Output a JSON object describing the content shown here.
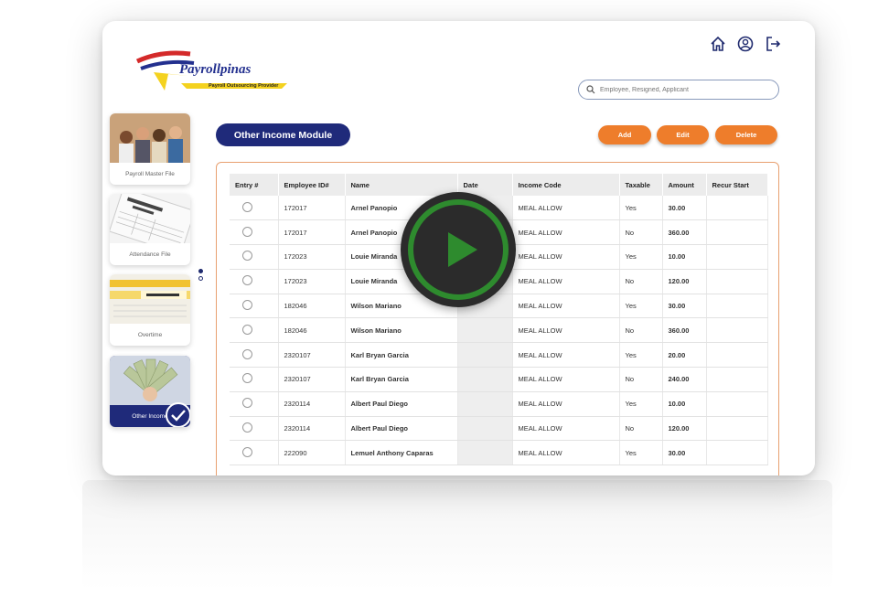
{
  "app": {
    "logo_text": "Payrollpinas",
    "logo_subtitle": "Payroll Outsourcing Provider"
  },
  "header_icons": [
    "home-icon",
    "user-icon",
    "logout-icon"
  ],
  "search": {
    "placeholder": "Employee, Resigned, Applicant"
  },
  "sidebar": {
    "items": [
      {
        "label": "Payroll Master File"
      },
      {
        "label": "Attendance File"
      },
      {
        "label": "Overtime"
      },
      {
        "label": "Other Income",
        "selected": true
      }
    ]
  },
  "module": {
    "title": "Other Income Module"
  },
  "toolbar": {
    "add_label": "Add",
    "edit_label": "Edit",
    "delete_label": "Delete"
  },
  "colors": {
    "primary": "#1f2a7a",
    "accent": "#ee7d2b",
    "play_ring": "#2e8b2e"
  },
  "table": {
    "columns": [
      "Entry #",
      "Employee ID#",
      "Name",
      "Date",
      "Income Code",
      "Taxable",
      "Amount",
      "Recur Start"
    ],
    "rows": [
      {
        "id": "172017",
        "name": "Arnel Panopio",
        "date": "",
        "code": "MEAL ALLOW",
        "taxable": "Yes",
        "amount": "30.00",
        "recur": ""
      },
      {
        "id": "172017",
        "name": "Arnel Panopio",
        "date": "",
        "code": "MEAL ALLOW",
        "taxable": "No",
        "amount": "360.00",
        "recur": ""
      },
      {
        "id": "172023",
        "name": "Louie Miranda",
        "date": "",
        "code": "MEAL ALLOW",
        "taxable": "Yes",
        "amount": "10.00",
        "recur": ""
      },
      {
        "id": "172023",
        "name": "Louie Miranda",
        "date": "",
        "code": "MEAL ALLOW",
        "taxable": "No",
        "amount": "120.00",
        "recur": ""
      },
      {
        "id": "182046",
        "name": "Wilson Mariano",
        "date": "",
        "code": "MEAL ALLOW",
        "taxable": "Yes",
        "amount": "30.00",
        "recur": ""
      },
      {
        "id": "182046",
        "name": "Wilson Mariano",
        "date": "",
        "code": "MEAL ALLOW",
        "taxable": "No",
        "amount": "360.00",
        "recur": ""
      },
      {
        "id": "2320107",
        "name": "Karl Bryan Garcia",
        "date": "",
        "code": "MEAL ALLOW",
        "taxable": "Yes",
        "amount": "20.00",
        "recur": ""
      },
      {
        "id": "2320107",
        "name": "Karl Bryan Garcia",
        "date": "",
        "code": "MEAL ALLOW",
        "taxable": "No",
        "amount": "240.00",
        "recur": ""
      },
      {
        "id": "2320114",
        "name": "Albert Paul Diego",
        "date": "",
        "code": "MEAL ALLOW",
        "taxable": "Yes",
        "amount": "10.00",
        "recur": ""
      },
      {
        "id": "2320114",
        "name": "Albert Paul Diego",
        "date": "",
        "code": "MEAL ALLOW",
        "taxable": "No",
        "amount": "120.00",
        "recur": ""
      },
      {
        "id": "222090",
        "name": "Lemuel Anthony Caparas",
        "date": "",
        "code": "MEAL ALLOW",
        "taxable": "Yes",
        "amount": "30.00",
        "recur": ""
      }
    ]
  }
}
